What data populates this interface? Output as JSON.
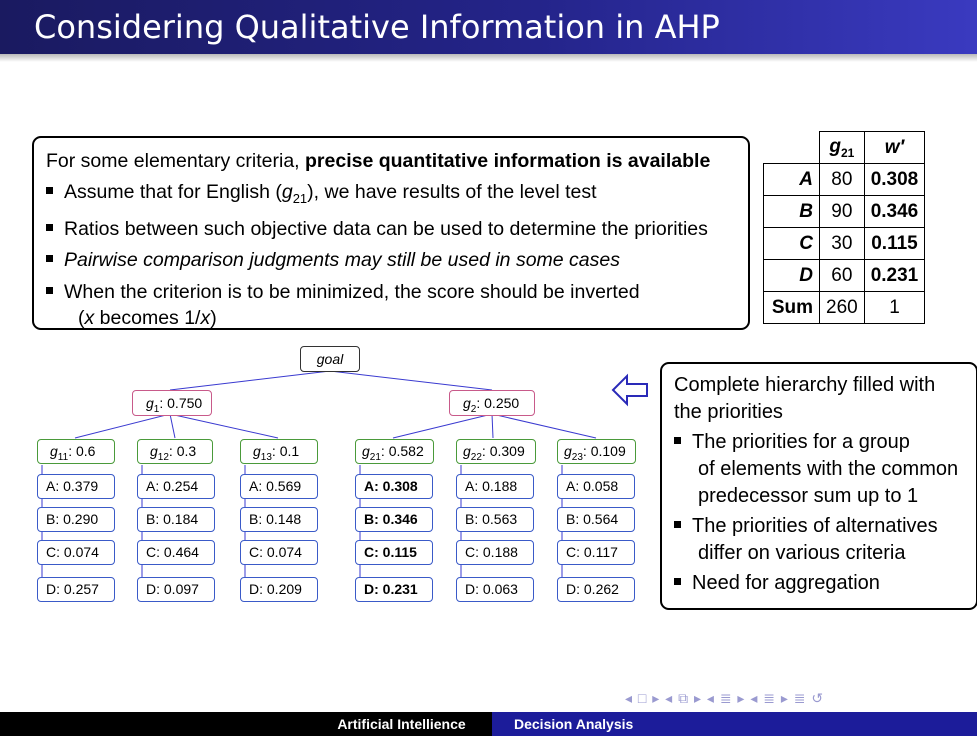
{
  "slide": {
    "title": "Considering Qualitative Information in AHP"
  },
  "info": {
    "intro_plain": "For some elementary criteria, ",
    "intro_bold": "precise quantitative information is available",
    "b1_a": "Assume that for English (",
    "b1_var": "g",
    "b1_sub": "21",
    "b1_b": "), we have results of the level test",
    "b2": "Ratios between such objective data can be used to determine the priorities",
    "b3": "Pairwise comparison judgments may still be used in some cases",
    "b4": "When the criterion is to be minimized, the score should be inverted",
    "b4_cont_a": "(",
    "b4_cont_x": "x",
    "b4_cont_b": " becomes 1/",
    "b4_cont_x2": "x",
    "b4_cont_c": ")"
  },
  "score_table": {
    "col1_var": "g",
    "col1_sub": "21",
    "col2": "w′",
    "rows": [
      {
        "label": "A",
        "g": "80",
        "w": "0.308"
      },
      {
        "label": "B",
        "g": "90",
        "w": "0.346"
      },
      {
        "label": "C",
        "g": "30",
        "w": "0.115"
      },
      {
        "label": "D",
        "g": "60",
        "w": "0.231"
      }
    ],
    "sum_label": "Sum",
    "sum_g": "260",
    "sum_w": "1"
  },
  "hierarchy": {
    "goal": "goal",
    "g1": {
      "var": "g",
      "sub": "1",
      "value": ": 0.750"
    },
    "g2": {
      "var": "g",
      "sub": "2",
      "value": ": 0.250"
    },
    "criteria": [
      {
        "sub": "11",
        "value": ": 0.6",
        "alts": [
          "A: 0.379",
          "B: 0.290",
          "C: 0.074",
          "D: 0.257"
        ]
      },
      {
        "sub": "12",
        "value": ": 0.3",
        "alts": [
          "A: 0.254",
          "B: 0.184",
          "C: 0.464",
          "D: 0.097"
        ]
      },
      {
        "sub": "13",
        "value": ": 0.1",
        "alts": [
          "A: 0.569",
          "B: 0.148",
          "C: 0.074",
          "D: 0.209"
        ]
      },
      {
        "sub": "21",
        "value": ": 0.582",
        "alts": [
          "A: 0.308",
          "B: 0.346",
          "C: 0.115",
          "D: 0.231"
        ]
      },
      {
        "sub": "22",
        "value": ": 0.309",
        "alts": [
          "A: 0.188",
          "B: 0.563",
          "C: 0.188",
          "D: 0.063"
        ]
      },
      {
        "sub": "23",
        "value": ": 0.109",
        "alts": [
          "A: 0.058",
          "B: 0.564",
          "C: 0.117",
          "D: 0.262"
        ]
      }
    ]
  },
  "side": {
    "head1": "Complete hierarchy filled with",
    "head2": "the priorities",
    "p1a": "The priorities for a group",
    "p1b": "of elements with the common",
    "p1c": "predecessor sum up to 1",
    "p2a": "The priorities of alternatives",
    "p2b": "differ on various criteria",
    "p3": "Need for aggregation"
  },
  "footer": {
    "left": "Artificial Intellience",
    "right": "Decision Analysis"
  },
  "colors": {
    "title_bar": "#24248a",
    "criteria_border": "#4a9a3a",
    "alternative_border": "#3a5ac8",
    "top_criteria_border": "#c85a8a",
    "connector": "#3a3ad0",
    "arrow": "#2a2ab8"
  },
  "nav": "◂ □ ▸ ◂ ⧉ ▸ ◂ ≣ ▸ ◂ ≣ ▸ ≣ ↺"
}
